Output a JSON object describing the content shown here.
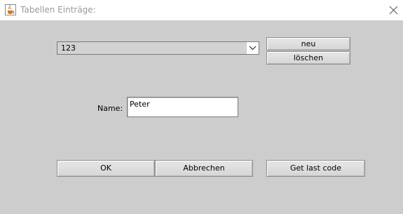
{
  "window": {
    "title": "Tabellen Einträge:",
    "app_icon": "java-cup-icon",
    "close_icon": "close-icon"
  },
  "combo": {
    "selected": "123",
    "arrow_icon": "chevron-down-icon"
  },
  "buttons": {
    "new_label": "neu",
    "delete_label": "löschen",
    "ok_label": "OK",
    "cancel_label": "Abbrechen",
    "get_last_code_label": "Get last code"
  },
  "form": {
    "name_label": "Name:",
    "name_value": "Peter"
  },
  "colors": {
    "background": "#cdcdcd",
    "titlebar": "#ffffff",
    "field": "#ffffff"
  }
}
